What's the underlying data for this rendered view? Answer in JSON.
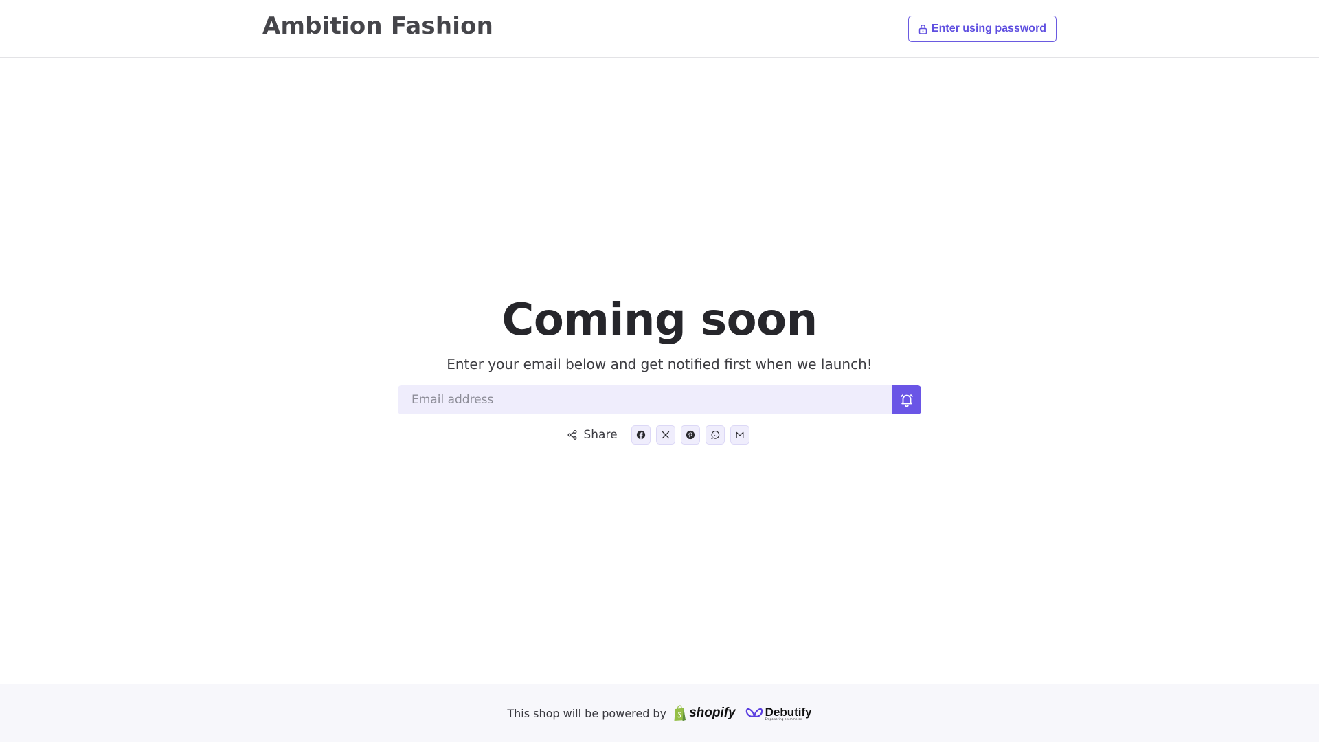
{
  "header": {
    "brand": "Ambition Fashion",
    "password_button_label": "Enter using password"
  },
  "hero": {
    "title": "Coming soon",
    "subtitle": "Enter your email below and get notified first when we launch!",
    "email_placeholder": "Email address"
  },
  "share": {
    "label": "Share",
    "buttons": [
      {
        "name": "facebook",
        "icon": "facebook-icon"
      },
      {
        "name": "x",
        "icon": "x-icon"
      },
      {
        "name": "pinterest",
        "icon": "pinterest-icon"
      },
      {
        "name": "whatsapp",
        "icon": "whatsapp-icon"
      },
      {
        "name": "email",
        "icon": "mail-icon"
      }
    ]
  },
  "footer": {
    "powered_text": "This shop will be powered by",
    "shopify_word": "shopify",
    "debutify_word": "Debutify",
    "debutify_tagline": "Empowering ecommerce"
  },
  "colors": {
    "accent": "#6a55e6",
    "input_bg": "#efedfc",
    "footer_bg": "#f7f7fb"
  }
}
